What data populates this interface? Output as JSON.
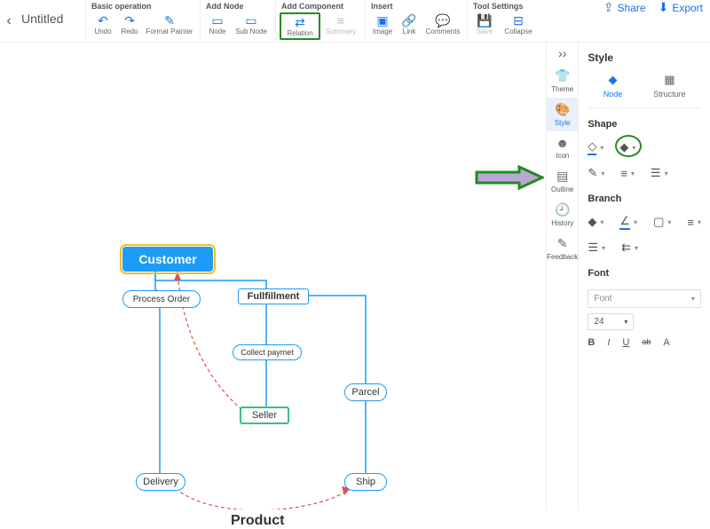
{
  "title": "Untitled",
  "toolbar": {
    "groups": [
      {
        "label": "Basic operation",
        "items": [
          {
            "name": "undo",
            "label": "Undo",
            "icon": "↶"
          },
          {
            "name": "redo",
            "label": "Redo",
            "icon": "↷"
          },
          {
            "name": "format-painter",
            "label": "Format Painter",
            "icon": "✎",
            "xwide": true
          }
        ]
      },
      {
        "label": "Add Node",
        "items": [
          {
            "name": "node",
            "label": "Node",
            "icon": "▭"
          },
          {
            "name": "sub-node",
            "label": "Sub Node",
            "icon": "▭",
            "wide": true
          }
        ]
      },
      {
        "label": "Add Component",
        "items": [
          {
            "name": "relation",
            "label": "Relation",
            "icon": "⇄",
            "highlight": true,
            "wide": true
          },
          {
            "name": "summary",
            "label": "Summary",
            "icon": "≡",
            "disabled": true,
            "wide": true
          }
        ]
      },
      {
        "label": "Insert",
        "items": [
          {
            "name": "image",
            "label": "Image",
            "icon": "▣"
          },
          {
            "name": "link",
            "label": "Link",
            "icon": "🔗"
          },
          {
            "name": "comments",
            "label": "Comments",
            "icon": "💬",
            "wide": true
          }
        ]
      },
      {
        "label": "Tool Settings",
        "items": [
          {
            "name": "save",
            "label": "Save",
            "icon": "💾",
            "disabled": true
          },
          {
            "name": "collapse",
            "label": "Collapse",
            "icon": "⊟",
            "wide": true
          }
        ]
      }
    ]
  },
  "actions": {
    "share": "Share",
    "export": "Export"
  },
  "rail": {
    "collapse": "››",
    "items": [
      {
        "name": "theme",
        "label": "Theme",
        "icon": "👕"
      },
      {
        "name": "style",
        "label": "Style",
        "icon": "🎨",
        "active": true
      },
      {
        "name": "icon",
        "label": "Icon",
        "icon": "☻"
      },
      {
        "name": "outline",
        "label": "Outline",
        "icon": "▤"
      },
      {
        "name": "history",
        "label": "History",
        "icon": "🕘"
      },
      {
        "name": "feedback",
        "label": "Feedback",
        "icon": "✎"
      }
    ]
  },
  "panel": {
    "title": "Style",
    "tabs": {
      "node": "Node",
      "structure": "Structure"
    },
    "shape_label": "Shape",
    "branch_label": "Branch",
    "font_label": "Font",
    "font_placeholder": "Font",
    "font_size": "24"
  },
  "canvas": {
    "nodes": {
      "customer": "Customer",
      "process_order": "Process Order",
      "fullfillment": "Fullfillment",
      "collect_paymet": "Collect paymet",
      "seller": "Seller",
      "parcel": "Parcel",
      "delivery": "Delivery",
      "ship": "Ship"
    },
    "label_product": "Product"
  },
  "chart_data": {
    "type": "diagram",
    "nodes": [
      {
        "id": "customer",
        "label": "Customer",
        "type": "root"
      },
      {
        "id": "process_order",
        "label": "Process Order",
        "type": "pill",
        "parent": "customer"
      },
      {
        "id": "fullfillment",
        "label": "Fullfillment",
        "type": "rect",
        "parent": "customer"
      },
      {
        "id": "collect_paymet",
        "label": "Collect paymet",
        "type": "pill",
        "parent": "fullfillment"
      },
      {
        "id": "seller",
        "label": "Seller",
        "type": "green",
        "parent": "collect_paymet"
      },
      {
        "id": "parcel",
        "label": "Parcel",
        "type": "pill",
        "parent": "fullfillment"
      },
      {
        "id": "delivery",
        "label": "Delivery",
        "type": "pill",
        "parent": "process_order"
      },
      {
        "id": "ship",
        "label": "Ship",
        "type": "pill",
        "parent": "parcel"
      }
    ],
    "relations": [
      {
        "from": "seller",
        "to": "customer",
        "style": "dashed-red"
      },
      {
        "from": "delivery",
        "to": "ship",
        "style": "dashed-red",
        "label": "Product"
      }
    ]
  }
}
